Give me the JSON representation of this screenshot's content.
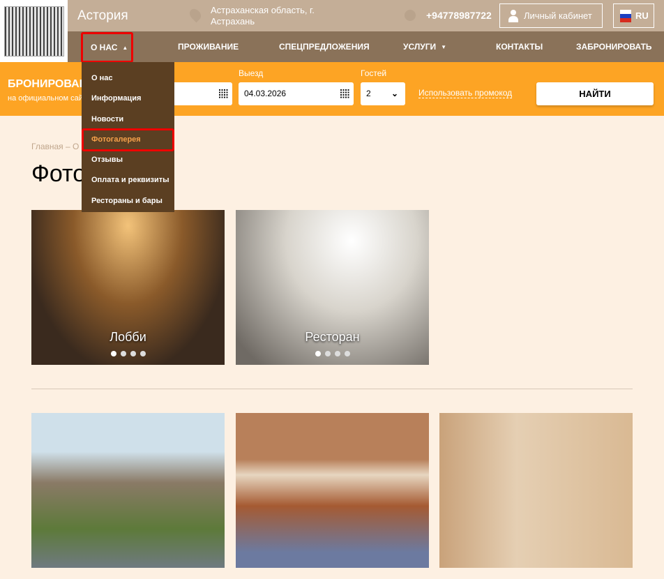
{
  "header": {
    "brand": "Астория",
    "address": "Астраханская область, г. Астрахань",
    "phone": "+94778987722",
    "cabinet": "Личный кабинет",
    "lang": "RU"
  },
  "nav": [
    "О НАС",
    "ПРОЖИВАНИЕ",
    "СПЕЦПРЕДЛОЖЕНИЯ",
    "УСЛУГИ",
    "КОНТАКТЫ",
    "ЗАБРОНИРОВАТЬ"
  ],
  "booking": {
    "title": "БРОНИРОВАНИЕ",
    "subtitle": "на официальном сайте",
    "checkout_label": "Выезд",
    "checkout": "04.03.2026",
    "guests_label": "Гостей",
    "guests": "2",
    "promo": "Использовать промокод",
    "search": "НАЙТИ"
  },
  "dropdown": [
    "О нас",
    "Информация",
    "Новости",
    "Фотогалерея",
    "Отзывы",
    "Оплата и реквизиты",
    "Рестораны и бары"
  ],
  "breadcrumb": "Главная – О нас – Фотогалерея",
  "page_title": "Фотогалерея",
  "gallery": [
    {
      "caption": "Лобби"
    },
    {
      "caption": "Ресторан"
    }
  ]
}
